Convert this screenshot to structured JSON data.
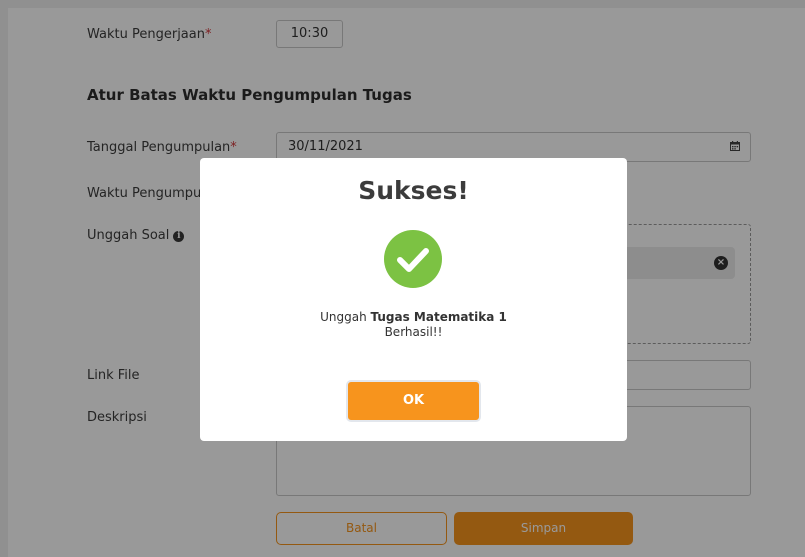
{
  "form": {
    "waktu_pengerjaan_label": "Waktu Pengerjaan",
    "required_mark": "*",
    "waktu_pengerjaan_value": "10:30",
    "section_title": "Atur Batas Waktu Pengumpulan Tugas",
    "tanggal_label": "Tanggal Pengumpulan",
    "tanggal_value": "30/11/2021",
    "waktu_pengumpulan_label": "Waktu Pengumpulan",
    "unggah_label": "Unggah Soal",
    "link_label": "Link File",
    "deskripsi_label": "Deskripsi",
    "batal_label": "Batal",
    "simpan_label": "Simpan"
  },
  "icons": {
    "calendar": "calendar-icon",
    "info": "info-icon",
    "remove_file": "close-circle-icon",
    "success": "check-circle-icon"
  },
  "modal": {
    "title": "Sukses!",
    "message_prefix": "Unggah ",
    "task_name": "Tugas Matematika 1",
    "message_suffix": "Berhasil!!",
    "ok_label": "OK"
  },
  "colors": {
    "accent": "#f7941d",
    "success": "#7cc243",
    "required": "#d13438"
  }
}
